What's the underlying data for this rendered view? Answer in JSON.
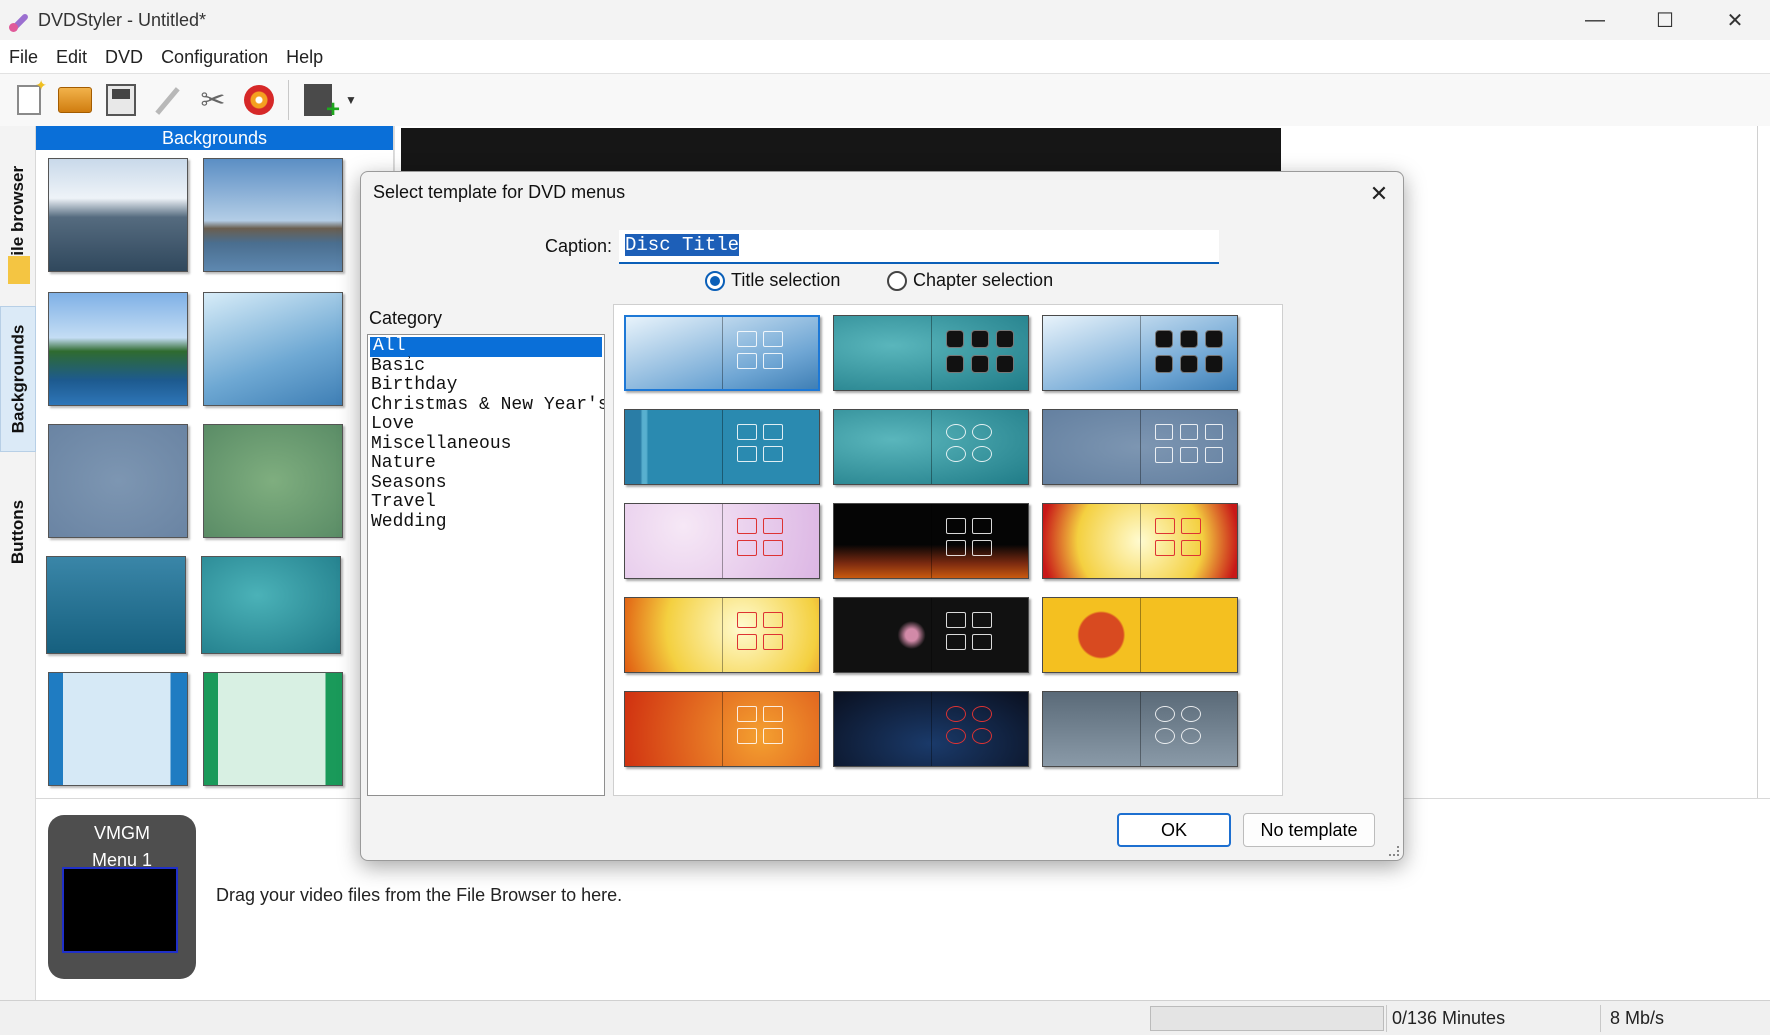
{
  "window": {
    "title": "DVDStyler - Untitled*",
    "controls": {
      "minimize": "—",
      "maximize": "☐",
      "close": "✕"
    }
  },
  "menubar": [
    "File",
    "Edit",
    "DVD",
    "Configuration",
    "Help"
  ],
  "toolbar": {
    "icons": [
      "new-file-icon",
      "open-folder-icon",
      "save-icon",
      "wizard-icon",
      "settings-tools-icon",
      "burn-disc-icon",
      "add-file-icon"
    ],
    "dropdown_glyph": "▼"
  },
  "side_tabs": [
    "File browser",
    "Backgrounds",
    "Buttons"
  ],
  "backgrounds_panel": {
    "header": "Backgrounds"
  },
  "titleset": {
    "vmgm_label": "VMGM",
    "menu_label": "Menu 1",
    "drag_hint": "Drag your video files from the File Browser to here."
  },
  "statusbar": {
    "minutes": "0/136 Minutes",
    "rate": "8 Mb/s"
  },
  "dialog": {
    "title": "Select template for DVD menus",
    "close_glyph": "✕",
    "caption_label": "Caption:",
    "caption_value": "Disc Title",
    "radio_title": "Title selection",
    "radio_chapter": "Chapter selection",
    "selected_radio": "title",
    "category_label": "Category",
    "categories": [
      "All",
      "Basic",
      "Birthday",
      "Christmas & New Year's Ev",
      "Love",
      "Miscellaneous",
      "Nature",
      "Seasons",
      "Travel",
      "Wedding"
    ],
    "selected_category": "All",
    "ok_label": "OK",
    "no_template_label": "No template"
  },
  "colors": {
    "accent": "#0a6fd8",
    "focus_border": "#1d6fd0"
  }
}
